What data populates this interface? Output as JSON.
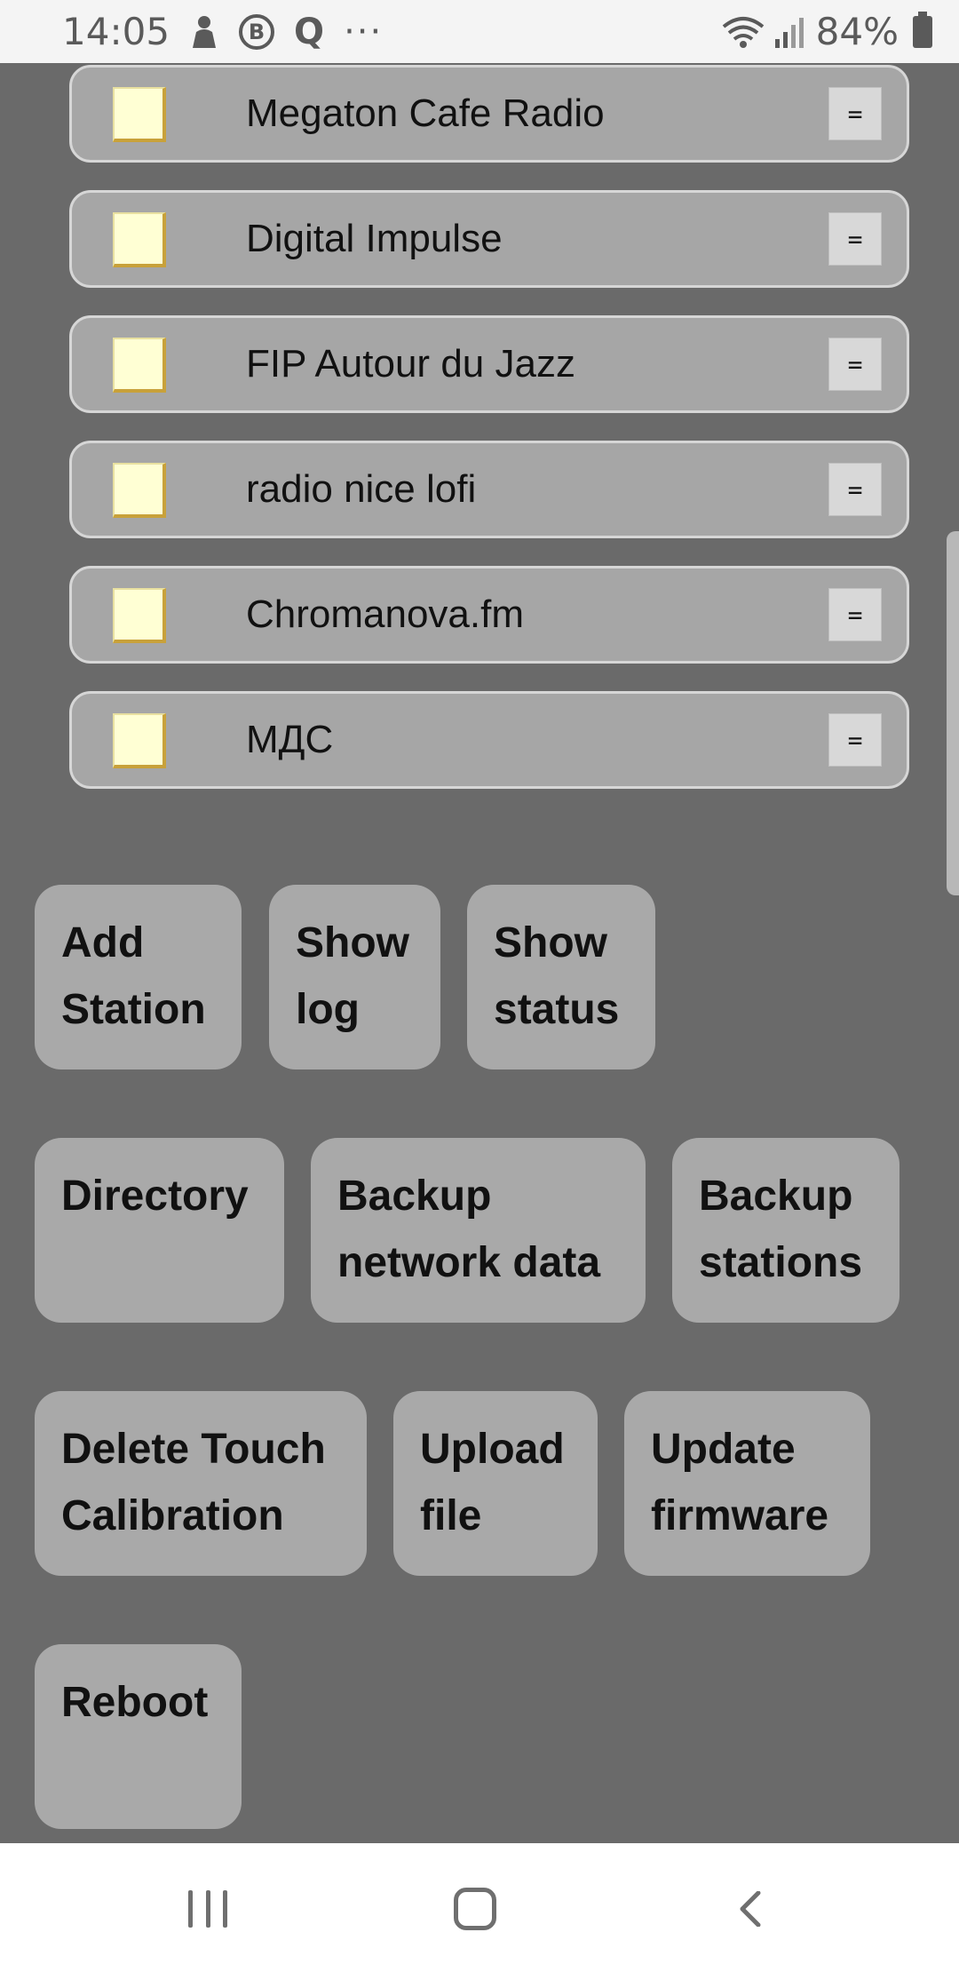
{
  "status_bar": {
    "time": "14:05",
    "b_icon_letter": "B",
    "q_icon_letter": "Q",
    "more_dots": "···",
    "battery_percent": "84%",
    "icons": [
      "notification-person-icon",
      "b-circle-icon",
      "q-icon",
      "more-icon",
      "wifi-icon",
      "signal-icon",
      "battery-icon"
    ]
  },
  "stations": [
    {
      "name": "Megaton Cafe Radio",
      "handle": "="
    },
    {
      "name": "Digital Impulse",
      "handle": "="
    },
    {
      "name": "FIP Autour du Jazz",
      "handle": "="
    },
    {
      "name": "radio nice lofi",
      "handle": "="
    },
    {
      "name": "Chromanova.fm",
      "handle": "="
    },
    {
      "name": "МДС",
      "handle": "="
    }
  ],
  "buttons": {
    "add_station": "Add\nStation",
    "show_log": "Show\nlog",
    "show_status": "Show\nstatus",
    "directory": "Directory",
    "backup_network": "Backup\nnetwork data",
    "backup_stations": "Backup\nstations",
    "delete_touch": "Delete Touch\nCalibration",
    "upload_file": "Upload\nfile",
    "update_firmware": "Update\nfirmware",
    "reboot": "Reboot"
  },
  "nav_bar": {
    "icons": [
      "recent-apps-icon",
      "home-icon",
      "back-icon"
    ]
  },
  "colors": {
    "page_background": "#6a6a6a",
    "button_background": "#a9a9a9",
    "checkbox_fill": "#ffffd4"
  }
}
